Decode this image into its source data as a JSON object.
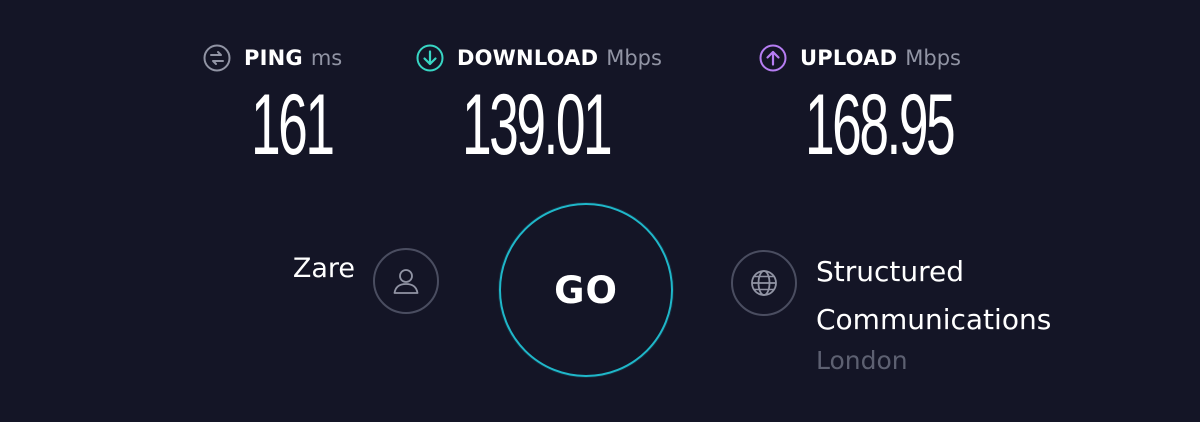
{
  "colors": {
    "background": "#141526",
    "ping_icon": "#9194a4",
    "download_icon": "#38d6c4",
    "upload_icon": "#b67df3",
    "go_ring": "#1fb7c9",
    "muted_text": "#5d6071"
  },
  "metrics": {
    "ping": {
      "icon": "ping-icon",
      "label": "PING",
      "unit": "ms",
      "value": "161"
    },
    "download": {
      "icon": "download-arrow-icon",
      "label": "DOWNLOAD",
      "unit": "Mbps",
      "value": "139.01"
    },
    "upload": {
      "icon": "upload-arrow-icon",
      "label": "UPLOAD",
      "unit": "Mbps",
      "value": "168.95"
    }
  },
  "user": {
    "name": "Zare",
    "icon": "person-icon"
  },
  "go_button": {
    "label": "GO"
  },
  "server": {
    "icon": "globe-icon",
    "name_line1": "Structured",
    "name_line2": "Communications",
    "location": "London"
  }
}
